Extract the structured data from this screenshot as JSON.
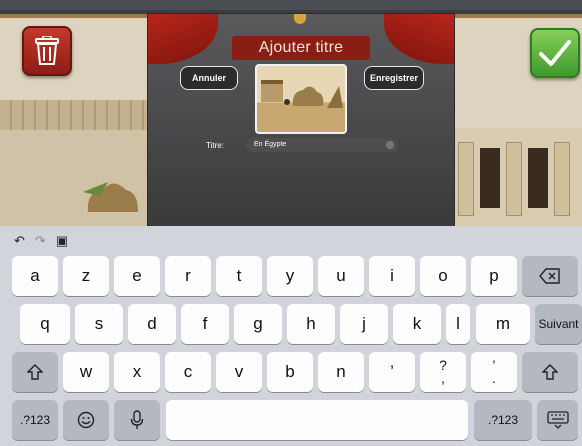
{
  "dialog": {
    "title": "Ajouter titre",
    "cancel_label": "Annuler",
    "save_label": "Enregistrer",
    "field_label": "Titre:",
    "field_value": "En Égypte"
  },
  "icons": {
    "delete": "trash-icon",
    "confirm": "checkmark-icon",
    "undo": "undo-icon",
    "redo": "redo-icon",
    "paste": "paste-icon",
    "backspace": "backspace-icon",
    "shift": "shift-icon",
    "emoji": "emoji-icon",
    "dictation": "microphone-icon",
    "hide_keyboard": "keyboard-hide-icon"
  },
  "keyboard": {
    "row1": [
      "a",
      "z",
      "e",
      "r",
      "t",
      "y",
      "u",
      "i",
      "o",
      "p"
    ],
    "row2": [
      "q",
      "s",
      "d",
      "f",
      "g",
      "h",
      "j",
      "k",
      "l",
      "m"
    ],
    "return_label": "Suivant",
    "row3": [
      "w",
      "x",
      "c",
      "v",
      "b",
      "n",
      "’",
      "?\n,",
      "’\n."
    ],
    "numbers_label": ".?123"
  },
  "colors": {
    "delete": "#b02a1f",
    "confirm": "#5cb83a",
    "banner": "#8a1d14"
  }
}
